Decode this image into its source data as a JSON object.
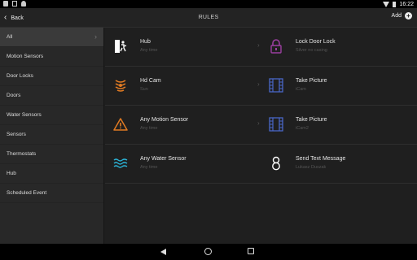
{
  "status_bar": {
    "time": "16:22"
  },
  "toolbar": {
    "back_label": "Back",
    "title": "RULES",
    "add_label": "Add"
  },
  "sidebar": {
    "items": [
      {
        "label": "All",
        "active": true
      },
      {
        "label": "Motion Sensors"
      },
      {
        "label": "Door Locks"
      },
      {
        "label": "Doors"
      },
      {
        "label": "Water Sensors"
      },
      {
        "label": "Sensors"
      },
      {
        "label": "Thermostats"
      },
      {
        "label": "Hub"
      },
      {
        "label": "Scheduled Event"
      }
    ]
  },
  "rules": [
    {
      "left": {
        "name": "Hub",
        "sub": "Any time",
        "icon": "door-exit-icon",
        "color": "#ffffff"
      },
      "right": {
        "name": "Lock Door Lock",
        "sub": "Silver no casing",
        "icon": "lock-icon",
        "color": "#9b3fa0"
      }
    },
    {
      "left": {
        "name": "Hd Cam",
        "sub": "Sun",
        "icon": "motion-sensor-icon",
        "color": "#e07a22"
      },
      "right": {
        "name": "Take Picture",
        "sub": "iCam",
        "icon": "film-strip-icon",
        "color": "#4a67c8"
      }
    },
    {
      "left": {
        "name": "Any Motion Sensor",
        "sub": "Any time",
        "icon": "warning-icon",
        "color": "#e07a22"
      },
      "right": {
        "name": "Take Picture",
        "sub": "iCam2",
        "icon": "film-strip-icon",
        "color": "#4a67c8"
      }
    },
    {
      "left": {
        "name": "Any Water Sensor",
        "sub": "Any time",
        "icon": "water-waves-icon",
        "color": "#2bb3d6"
      },
      "right": {
        "name": "Send Text Message",
        "sub": "Lukasz Duszak",
        "icon": "text-message-icon",
        "color": "#ffffff"
      }
    }
  ]
}
